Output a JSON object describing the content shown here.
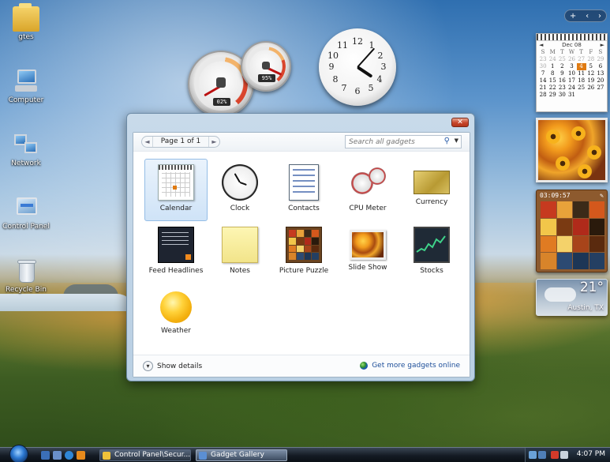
{
  "desktop_icons": [
    {
      "label": "gtes",
      "icon": "folder-icon"
    },
    {
      "label": "Computer",
      "icon": "computer-icon"
    },
    {
      "label": "Network",
      "icon": "network-icon"
    },
    {
      "label": "Control Panel",
      "icon": "control-panel-icon"
    },
    {
      "label": "Recycle Bin",
      "icon": "recycle-bin-icon"
    }
  ],
  "cpu_meter": {
    "cpu": "02%",
    "memory": "95%",
    "cpu_percent": 2,
    "memory_percent": 95
  },
  "clock": {
    "numerals": [
      "12",
      "1",
      "2",
      "3",
      "4",
      "5",
      "6",
      "7",
      "8",
      "9",
      "10",
      "11"
    ],
    "hour": 4,
    "minute": 7
  },
  "sidebar": {
    "controls": {
      "add": "+",
      "prev": "‹",
      "next": "›"
    },
    "calendar": {
      "month": "Dec 08",
      "prev": "◄",
      "next": "►",
      "day_headers": [
        "S",
        "M",
        "T",
        "W",
        "T",
        "F",
        "S"
      ],
      "leading_days": [
        "23",
        "24",
        "25",
        "26",
        "27",
        "28",
        "29"
      ],
      "days": [
        "30",
        "1",
        "2",
        "3",
        "4",
        "5",
        "6",
        "7",
        "8",
        "9",
        "10",
        "11",
        "12",
        "13",
        "14",
        "15",
        "16",
        "17",
        "18",
        "19",
        "20",
        "21",
        "22",
        "23",
        "24",
        "25",
        "26",
        "27",
        "28",
        "29",
        "30",
        "31"
      ],
      "today": "4"
    },
    "picture_puzzle": {
      "timer": "03:09:57"
    },
    "weather": {
      "temperature": "21°",
      "location": "Austin, TX"
    }
  },
  "gallery": {
    "close_label": "✕",
    "pager": {
      "text": "Page 1 of 1",
      "prev": "◄",
      "next": "►"
    },
    "search": {
      "placeholder": "Search all gadgets"
    },
    "gadgets": [
      {
        "label": "Calendar",
        "icon": "calendar-icon",
        "selected": true
      },
      {
        "label": "Clock",
        "icon": "clock-icon"
      },
      {
        "label": "Contacts",
        "icon": "contacts-icon"
      },
      {
        "label": "CPU Meter",
        "icon": "cpu-meter-icon"
      },
      {
        "label": "Currency",
        "icon": "currency-icon"
      },
      {
        "label": "Feed Headlines",
        "icon": "feed-headlines-icon"
      },
      {
        "label": "Notes",
        "icon": "notes-icon"
      },
      {
        "label": "Picture Puzzle",
        "icon": "picture-puzzle-icon"
      },
      {
        "label": "Slide Show",
        "icon": "slide-show-icon"
      },
      {
        "label": "Stocks",
        "icon": "stocks-icon"
      },
      {
        "label": "Weather",
        "icon": "weather-icon"
      }
    ],
    "footer": {
      "show_details": "Show details",
      "more_online": "Get more gadgets online"
    }
  },
  "taskbar": {
    "buttons": [
      {
        "label": "Control Panel\\Secur...",
        "icon": "control-panel-icon"
      },
      {
        "label": "Gadget Gallery",
        "icon": "gadget-gallery-icon",
        "active": true
      }
    ],
    "time": "4:07 PM"
  },
  "colors": {
    "selection": "#cfe3f7",
    "accent": "#e07b12",
    "link": "#1e4f9a"
  }
}
